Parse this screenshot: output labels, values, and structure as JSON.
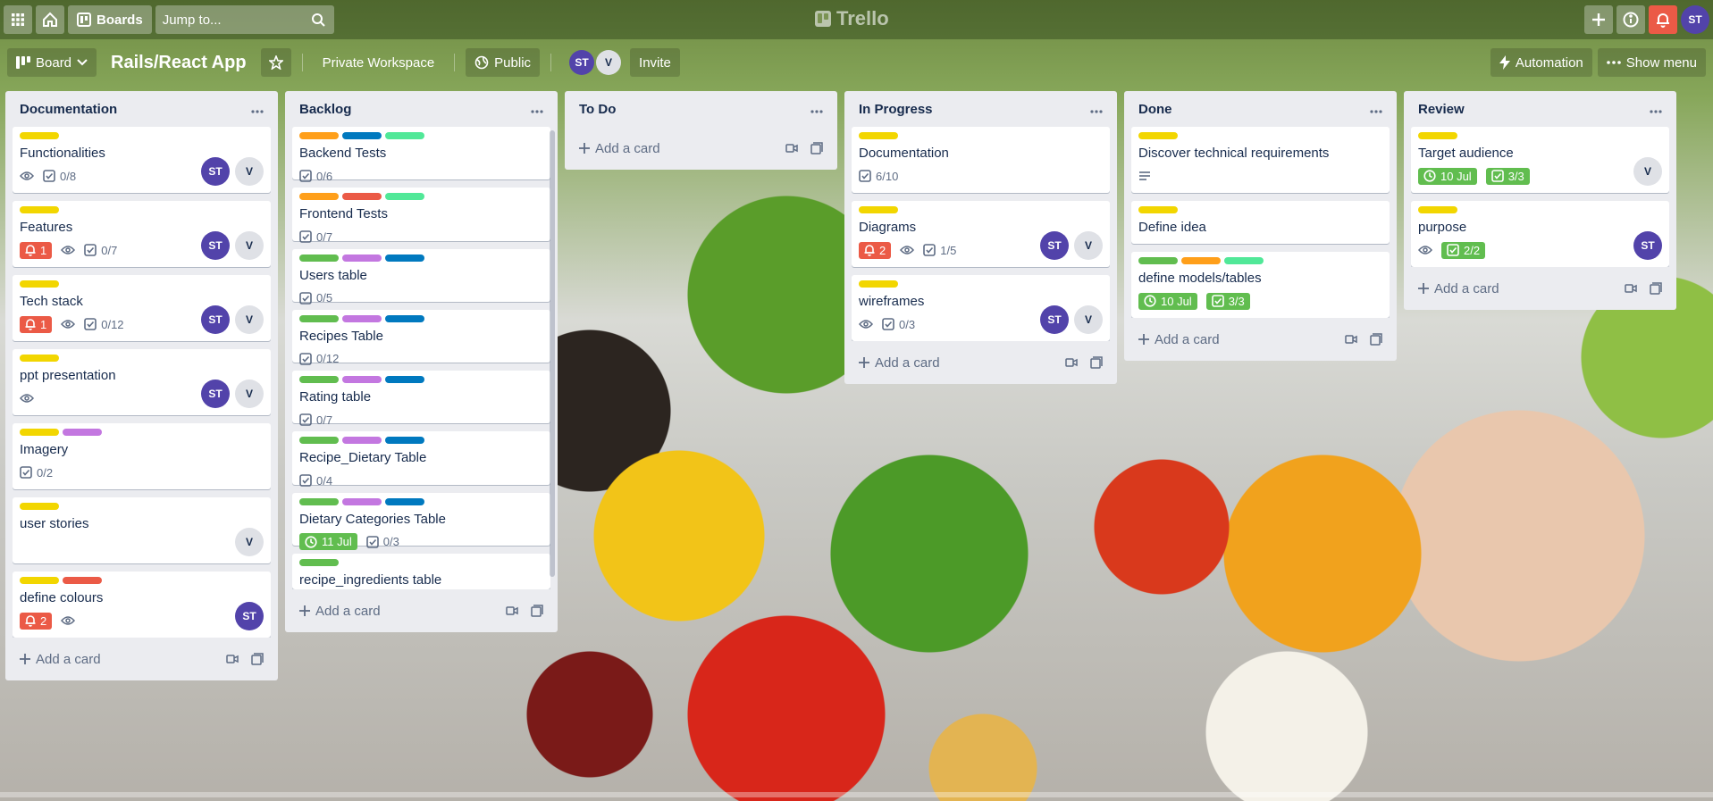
{
  "header": {
    "boards_label": "Boards",
    "search_placeholder": "Jump to...",
    "logo": "Trello",
    "user_initials": "ST"
  },
  "board": {
    "view_label": "Board",
    "title": "Rails/React App",
    "workspace_label": "Private Workspace",
    "visibility_label": "Public",
    "members": [
      "ST",
      "V"
    ],
    "invite_label": "Invite",
    "automation_label": "Automation",
    "show_menu_label": "Show menu"
  },
  "colors": {
    "yellow": "#f2d600",
    "orange": "#ff9f1a",
    "red": "#eb5a46",
    "green": "#61bd4f",
    "purple": "#c377e0",
    "blue": "#0079bf",
    "lime": "#51e898",
    "avatar": "#5243aa"
  },
  "add_card_label": "Add a card",
  "lists": [
    {
      "title": "Documentation",
      "cards": [
        {
          "labels": [
            "yellow"
          ],
          "title": "Functionalities",
          "watch": true,
          "checklist": "0/8",
          "members": [
            "ST",
            "V"
          ]
        },
        {
          "labels": [
            "yellow"
          ],
          "title": "Features",
          "notify": "1",
          "watch": true,
          "checklist": "0/7",
          "members": [
            "ST",
            "V"
          ]
        },
        {
          "labels": [
            "yellow"
          ],
          "title": "Tech stack",
          "notify": "1",
          "watch": true,
          "checklist": "0/12",
          "members": [
            "ST",
            "V"
          ]
        },
        {
          "labels": [
            "yellow"
          ],
          "title": "ppt presentation",
          "watch": true,
          "members": [
            "ST",
            "V"
          ]
        },
        {
          "labels": [
            "yellow",
            "purple"
          ],
          "title": "Imagery",
          "checklist": "0/2"
        },
        {
          "labels": [
            "yellow"
          ],
          "title": "user stories",
          "members": [
            "V"
          ]
        },
        {
          "labels": [
            "yellow",
            "red"
          ],
          "title": "define colours",
          "notify": "2",
          "watch": true,
          "members": [
            "ST"
          ]
        }
      ]
    },
    {
      "title": "Backlog",
      "cards": [
        {
          "labels": [
            "orange",
            "blue",
            "lime"
          ],
          "title": "Backend Tests",
          "checklist": "0/6"
        },
        {
          "labels": [
            "orange",
            "red",
            "lime"
          ],
          "title": "Frontend Tests",
          "checklist": "0/7"
        },
        {
          "labels": [
            "green",
            "purple",
            "blue"
          ],
          "title": "Users table",
          "checklist": "0/5"
        },
        {
          "labels": [
            "green",
            "purple",
            "blue"
          ],
          "title": "Recipes Table",
          "checklist": "0/12"
        },
        {
          "labels": [
            "green",
            "purple",
            "blue"
          ],
          "title": "Rating table",
          "checklist": "0/7"
        },
        {
          "labels": [
            "green",
            "purple",
            "blue"
          ],
          "title": "Recipe_Dietary Table",
          "checklist": "0/4"
        },
        {
          "labels": [
            "green",
            "purple",
            "blue"
          ],
          "title": "Dietary Categories Table",
          "due": "11 Jul",
          "checklist": "0/3"
        },
        {
          "labels": [
            "green"
          ],
          "title": "recipe_ingredients table"
        }
      ]
    },
    {
      "title": "To Do",
      "cards": []
    },
    {
      "title": "In Progress",
      "cards": [
        {
          "labels": [
            "yellow"
          ],
          "title": "Documentation",
          "checklist": "6/10"
        },
        {
          "labels": [
            "yellow"
          ],
          "title": "Diagrams",
          "notify": "2",
          "watch": true,
          "checklist": "1/5",
          "members": [
            "ST",
            "V"
          ]
        },
        {
          "labels": [
            "yellow"
          ],
          "title": "wireframes",
          "watch": true,
          "checklist": "0/3",
          "members": [
            "ST",
            "V"
          ]
        }
      ]
    },
    {
      "title": "Done",
      "cards": [
        {
          "labels": [
            "yellow"
          ],
          "title": "Discover technical requirements",
          "description": true
        },
        {
          "labels": [
            "yellow"
          ],
          "title": "Define idea"
        },
        {
          "labels": [
            "green",
            "orange",
            "lime"
          ],
          "title": "define models/tables",
          "due_done": "10 Jul",
          "checklist_done": "3/3"
        }
      ]
    },
    {
      "title": "Review",
      "cards": [
        {
          "labels": [
            "yellow"
          ],
          "title": "Target audience",
          "due_done": "10 Jul",
          "checklist_done": "3/3",
          "members": [
            "V"
          ]
        },
        {
          "labels": [
            "yellow"
          ],
          "title": "purpose",
          "watch": true,
          "checklist_done": "2/2",
          "members": [
            "ST"
          ]
        }
      ]
    }
  ]
}
